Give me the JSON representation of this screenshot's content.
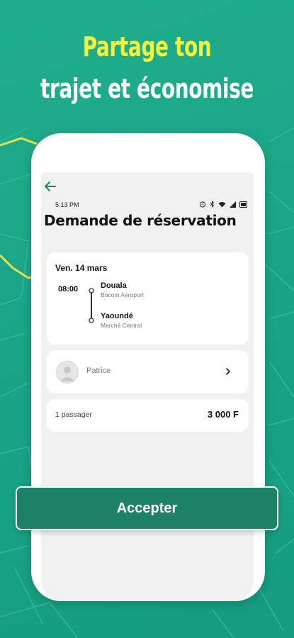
{
  "headline": {
    "line1": "Partage ton",
    "line2": "trajet et économise"
  },
  "colors": {
    "background": "#1aa587",
    "headline_accent": "#f4f23b",
    "button": "#1e8366",
    "map_path_accent": "#e8e04a"
  },
  "status_bar": {
    "time": "5:13 PM",
    "icons": [
      "alarm-icon",
      "bluetooth-icon",
      "wifi-icon",
      "signal-icon",
      "battery-icon"
    ]
  },
  "screen": {
    "back_icon": "back-arrow-icon",
    "title": "Demande de réservation"
  },
  "trip": {
    "date": "Ven. 14 mars",
    "departure_time": "08:00",
    "origin": {
      "city": "Douala",
      "place": "Bocom Aéroport"
    },
    "destination": {
      "city": "Yaoundé",
      "place": "Marché Central"
    }
  },
  "driver": {
    "name": "Patrice",
    "avatar_icon": "user-avatar-icon",
    "chevron_icon": "chevron-right-icon"
  },
  "booking": {
    "passengers": "1 passager",
    "price": "3 000 F"
  },
  "actions": {
    "accept_label": "Accepter"
  }
}
